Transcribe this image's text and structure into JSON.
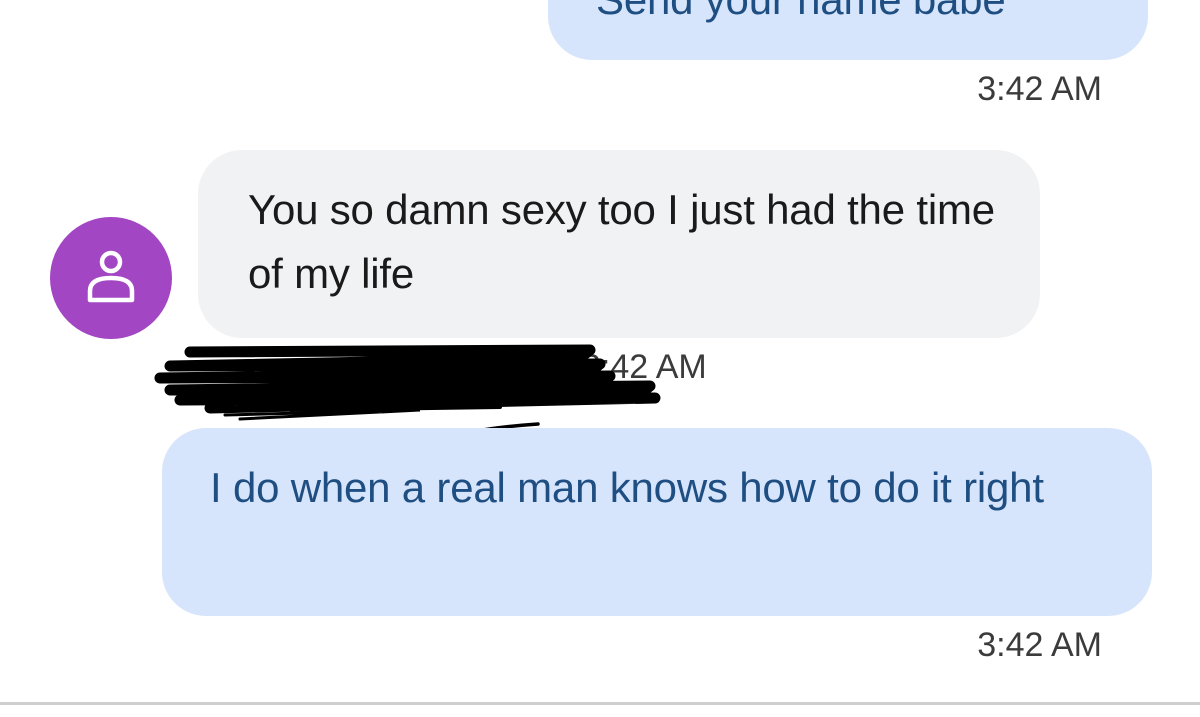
{
  "conversation": {
    "messages": [
      {
        "direction": "outgoing",
        "text": "Send your name babe",
        "timestamp": "3:42 AM"
      },
      {
        "direction": "incoming",
        "text": "You so damn sexy too I just had the time of my life",
        "timestamp": "3:42 AM",
        "avatar_icon": "person-icon",
        "avatar_color": "#a246c4"
      },
      {
        "direction": "outgoing",
        "text": "I do when a real man knows how to do it right",
        "timestamp": "3:42 AM"
      }
    ]
  },
  "colors": {
    "outgoing_bubble": "#d6e5fb",
    "outgoing_text": "#1f4e82",
    "incoming_bubble": "#f1f2f4",
    "redaction": "#000000"
  }
}
